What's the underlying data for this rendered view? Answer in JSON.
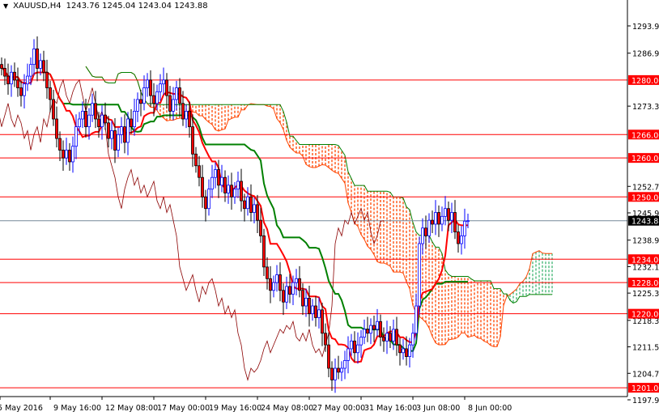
{
  "header": {
    "symbol": "XAUUSD,H4",
    "ohlc": "1243.76 1245.04 1243.04 1243.88",
    "menu_icon": "triangle-down-icon"
  },
  "colors": {
    "up_candle": "#0000ff",
    "down_candle_body": "#ff0000",
    "tenkan": "#ff0000",
    "kijun": "#008000",
    "chikou": "#8b0000",
    "cloud_bear": "#ff4500",
    "cloud_bull": "#3cb371",
    "level_line": "#ff0000",
    "bid_line": "#778899"
  },
  "chart_data": {
    "type": "candlestick",
    "title": "XAUUSD,H4",
    "indicator": "Ichimoku Kinko Hyo (9,26,52)",
    "ylim": [
      1195.5,
      1300.5
    ],
    "y_ticks": [
      "1293.90",
      "1286.90",
      "1273.30",
      "1252.70",
      "1245.90",
      "1238.90",
      "1232.10",
      "1225.30",
      "1218.30",
      "1211.50",
      "1204.70",
      "1197.90"
    ],
    "x_tick_labels": [
      "5 May 2016",
      "9 May 16:00",
      "12 May 08:00",
      "17 May 00:00",
      "19 May 16:00",
      "24 May 08:00",
      "27 May 00:00",
      "31 May 16:00",
      "3 Jun 08:00",
      "8 Jun 00:00"
    ],
    "x_tick_bars": [
      0,
      16,
      32,
      48,
      64,
      80,
      96,
      112,
      128,
      144
    ],
    "levels": [
      {
        "label": "1280.00",
        "value": 1280.0
      },
      {
        "label": "1266.00",
        "value": 1266.0
      },
      {
        "label": "1260.00",
        "value": 1260.0
      },
      {
        "label": "1250.00",
        "value": 1250.0
      },
      {
        "label": "1234.00",
        "value": 1234.0
      },
      {
        "label": "1228.00",
        "value": 1228.0
      },
      {
        "label": "1220.00",
        "value": 1220.0
      },
      {
        "label": "1201.00",
        "value": 1201.0
      }
    ],
    "bid": {
      "label": "1243.88",
      "value": 1243.88
    },
    "closes": [
      1283,
      1281,
      1279,
      1282,
      1280,
      1278,
      1276,
      1279,
      1281,
      1284,
      1288,
      1283,
      1285,
      1282,
      1278,
      1275,
      1270,
      1265,
      1262,
      1260,
      1262,
      1259,
      1263,
      1268,
      1270,
      1272,
      1268,
      1271,
      1274,
      1270,
      1268,
      1271,
      1269,
      1265,
      1267,
      1262,
      1266,
      1268,
      1264,
      1270,
      1268,
      1272,
      1275,
      1274,
      1278,
      1280,
      1276,
      1274,
      1277,
      1279,
      1280,
      1276,
      1272,
      1275,
      1278,
      1274,
      1270,
      1272,
      1268,
      1261,
      1258,
      1255,
      1250,
      1247,
      1252,
      1255,
      1257,
      1253,
      1255,
      1251,
      1253,
      1250,
      1252,
      1254,
      1249,
      1247,
      1250,
      1246,
      1248,
      1244,
      1240,
      1232,
      1229,
      1226,
      1228,
      1230,
      1226,
      1223,
      1227,
      1225,
      1228,
      1229,
      1226,
      1222,
      1224,
      1220,
      1222,
      1219,
      1221,
      1215,
      1212,
      1206,
      1203,
      1206,
      1205,
      1206,
      1208,
      1211,
      1213,
      1210,
      1212,
      1214,
      1216,
      1215,
      1217,
      1216,
      1218,
      1214,
      1213,
      1215,
      1213,
      1216,
      1212,
      1210,
      1211,
      1209,
      1212,
      1215,
      1222,
      1238,
      1242,
      1240,
      1244,
      1243,
      1246,
      1243,
      1245,
      1247,
      1244,
      1246,
      1241,
      1238,
      1240,
      1243.76,
      1243.88
    ]
  }
}
